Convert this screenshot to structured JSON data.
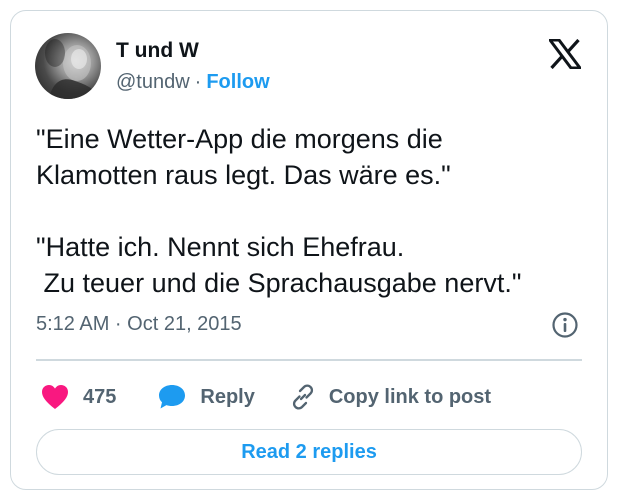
{
  "author": {
    "display_name": "T und W",
    "handle": "@tundw",
    "separator": "·",
    "follow_label": "Follow"
  },
  "tweet": {
    "text": "\"Eine Wetter-App die morgens die\nKlamotten raus legt. Das wäre es.\"\n\n\"Hatte ich. Nennt sich Ehefrau.\n Zu teuer und die Sprachausgabe nervt.\"",
    "timestamp": "5:12 AM · Oct 21, 2015"
  },
  "actions": {
    "like_count": "475",
    "reply_label": "Reply",
    "copy_link_label": "Copy link to post"
  },
  "read_replies_label": "Read 2 replies",
  "icons": {
    "brand": "x-logo-icon",
    "info": "info-icon",
    "like": "heart-icon",
    "reply": "speech-bubble-icon",
    "copy": "link-icon"
  },
  "colors": {
    "accent": "#1d9bf0",
    "like": "#f91880",
    "muted_text": "#536471",
    "border": "#cfd9de"
  }
}
